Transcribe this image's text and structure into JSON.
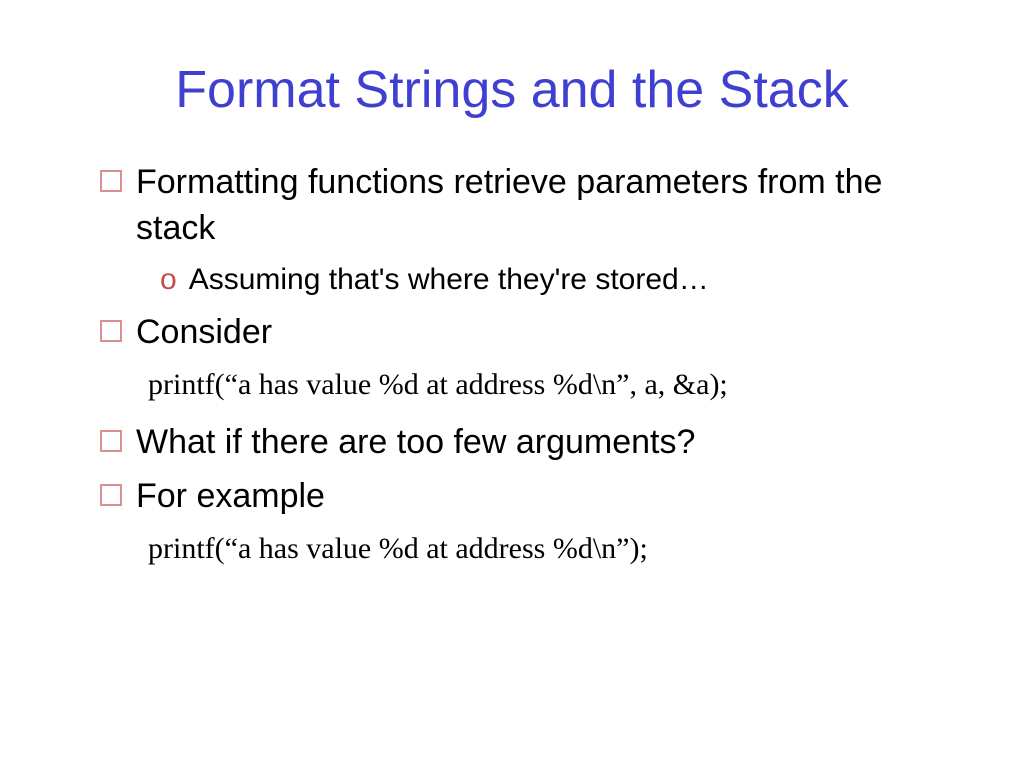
{
  "title": "Format Strings and the Stack",
  "items": [
    {
      "type": "l1",
      "text": "Formatting functions retrieve parameters from the stack"
    },
    {
      "type": "l2",
      "text": "Assuming that's where they're stored…"
    },
    {
      "type": "l1",
      "text": "Consider"
    },
    {
      "type": "code",
      "text": "printf(“a has value %d at address %d\\n”, a, &a);"
    },
    {
      "type": "l1",
      "text": "What if there are too few arguments?"
    },
    {
      "type": "l1",
      "text": "For example"
    },
    {
      "type": "code",
      "text": "printf(“a has value %d at address %d\\n”);"
    }
  ],
  "l2_marker": "o"
}
